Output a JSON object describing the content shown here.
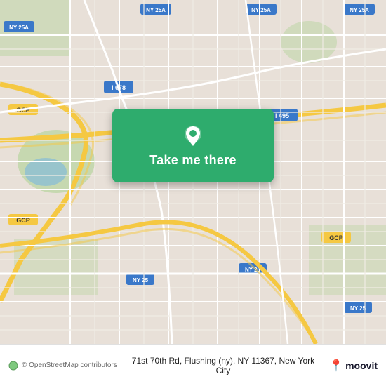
{
  "map": {
    "alt": "Map of Flushing NY area",
    "center_lat": 40.72,
    "center_lng": -73.83,
    "bg_color": "#e8e0d8",
    "road_color_highway": "#f5c842",
    "road_color_major": "#ffffff",
    "road_color_minor": "#f0ece4"
  },
  "button": {
    "label": "Take me there",
    "bg_color": "#2eac6d",
    "icon": "location-pin-icon"
  },
  "bottom_bar": {
    "osm_attribution": "© OpenStreetMap contributors",
    "address": "71st 70th Rd, Flushing (ny), NY 11367, New York City",
    "brand": "moovit",
    "bg_color": "#ffffff"
  }
}
